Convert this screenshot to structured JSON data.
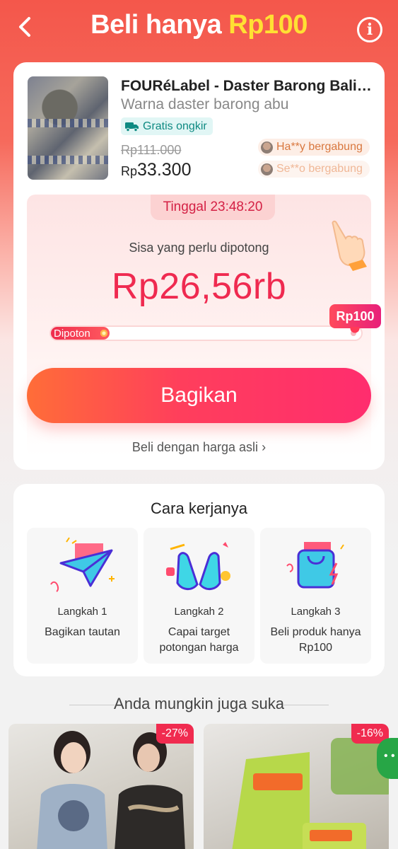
{
  "header": {
    "title_main": "Beli hanya ",
    "title_accent": "Rp100"
  },
  "product": {
    "name": "FOURéLabel - Daster Barong Bali ...",
    "variant": "Warna daster barong abu",
    "free_shipping": "Gratis ongkir",
    "old_price": "Rp111.000",
    "price_currency": "Rp",
    "price_amount": "33.300",
    "joined": [
      "Ha**y bergabung",
      "Se**o bergabung"
    ]
  },
  "cut": {
    "timer": "Tinggal 23:48:20",
    "remain_label": "Sisa yang perlu dipotong",
    "remain_value": "Rp26,56rb",
    "target_label": "Rp100",
    "progress_label": "Dipoton",
    "progress_fraction": 0.19,
    "share_button": "Bagikan",
    "buy_original": "Beli dengan harga asli"
  },
  "how": {
    "title": "Cara kerjanya",
    "steps": [
      {
        "num": "Langkah 1",
        "desc": "Bagikan tautan"
      },
      {
        "num": "Langkah 2",
        "desc": "Capai target potongan harga"
      },
      {
        "num": "Langkah 3",
        "desc": "Beli produk hanya Rp100"
      }
    ]
  },
  "recommend": {
    "title": "Anda mungkin juga suka",
    "items": [
      {
        "discount": "-27%"
      },
      {
        "discount": "-16%"
      }
    ]
  },
  "colors": {
    "accent": "#ef2a50",
    "title_accent": "#ffe033",
    "free_ship": "#0e8a82"
  }
}
